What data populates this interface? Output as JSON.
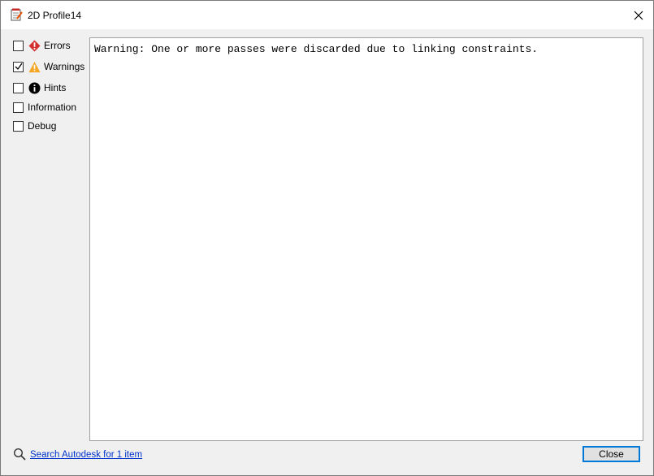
{
  "window": {
    "title": "2D Profile14"
  },
  "filters": [
    {
      "label": "Errors",
      "checked": false,
      "icon": "error-icon"
    },
    {
      "label": "Warnings",
      "checked": true,
      "icon": "warning-icon"
    },
    {
      "label": "Hints",
      "checked": false,
      "icon": "info-icon"
    },
    {
      "label": "Information",
      "checked": false,
      "icon": ""
    },
    {
      "label": "Debug",
      "checked": false,
      "icon": ""
    }
  ],
  "log": {
    "lines": [
      "Warning: One or more passes were discarded due to linking constraints."
    ]
  },
  "footer": {
    "search_link": "Search Autodesk for 1 item",
    "close_label": "Close"
  },
  "colors": {
    "error": "#d32f2f",
    "warning": "#f5a623",
    "hint": "#000000",
    "link": "#0033cc",
    "focus": "#0078d7"
  }
}
